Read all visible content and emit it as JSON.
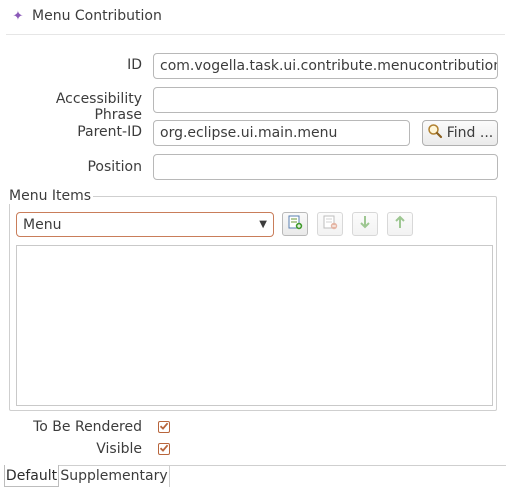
{
  "header": {
    "icon": "menu-contribution-icon",
    "title": "Menu Contribution"
  },
  "form": {
    "id_label": "ID",
    "id_value": "com.vogella.task.ui.contribute.menucontribution",
    "accessibility_label": "Accessibility Phrase",
    "accessibility_value": "",
    "parent_id_label": "Parent-ID",
    "parent_id_value": "org.eclipse.ui.main.menu",
    "find_button_label": "Find ...",
    "position_label": "Position",
    "position_value": ""
  },
  "menu_items": {
    "group_title": "Menu Items",
    "type_selected": "Menu",
    "toolbar": {
      "add_icon": "add-item-icon",
      "remove_icon": "remove-item-icon",
      "down_icon": "move-down-icon",
      "up_icon": "move-up-icon"
    },
    "items": []
  },
  "flags": {
    "to_be_rendered_label": "To Be Rendered",
    "to_be_rendered": true,
    "visible_label": "Visible",
    "visible": true
  },
  "tabs": [
    {
      "label": "Default",
      "active": true
    },
    {
      "label": "Supplementary",
      "active": false
    }
  ],
  "colors": {
    "accent_checkbox": "#b8653c",
    "combo_border": "#c97d5a",
    "title_icon": "#8b5ab8"
  }
}
